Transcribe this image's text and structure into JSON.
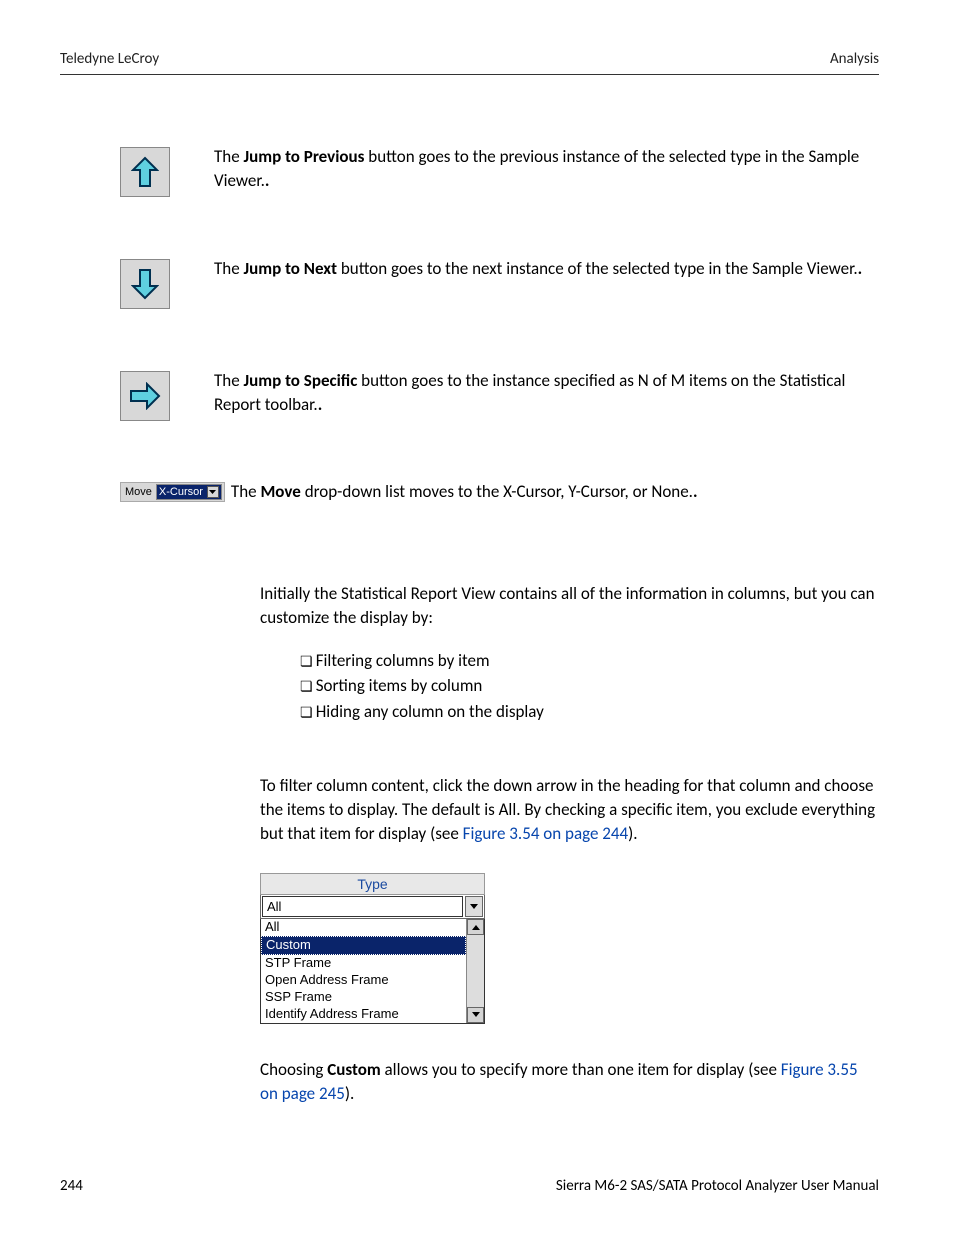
{
  "header": {
    "left": "Teledyne LeCroy",
    "right": "Analysis"
  },
  "items": [
    {
      "icon": "up-arrow",
      "prefix": "The ",
      "bold": "Jump to Previous",
      "suffix": " button goes to the previous instance of the selected type in the Sample Viewer."
    },
    {
      "icon": "down-arrow",
      "prefix": "The ",
      "bold": "Jump to Next",
      "suffix": " button goes to the next instance of the selected type in the Sample Viewer."
    },
    {
      "icon": "right-arrow",
      "prefix": "The ",
      "bold": "Jump to Specific",
      "suffix": " button goes to the instance specified as N of M items on the Statistical Report toolbar."
    }
  ],
  "move": {
    "label": "Move",
    "selected": "X-Cursor",
    "prefix": " The ",
    "bold": "Move",
    "suffix": " drop-down list moves to the X-Cursor, Y-Cursor, or None."
  },
  "intro": "Initially the Statistical Report View contains all of the information in columns, but you can customize the display by:",
  "bullets": [
    "Filtering columns by item",
    "Sorting items by column",
    "Hiding any column on the display"
  ],
  "filter_text": {
    "part1": "To filter column content, click the down arrow in the heading for that column and choose the items to display. The default is All. By checking a specific item, you exclude everything but that item for display (see ",
    "link": "Figure 3.54 on page 244",
    "part2": ")."
  },
  "dropdown": {
    "header": "Type",
    "value": "All",
    "options": [
      "All",
      "Custom",
      "STP Frame",
      "Open Address Frame",
      "SSP Frame",
      "Identify Address Frame"
    ],
    "selected_index": 1
  },
  "custom_text": {
    "part1": "Choosing ",
    "bold": "Custom",
    "part2": " allows you to specify more than one item for display (see ",
    "link": "Figure 3.55 on page 245",
    "part3": ")."
  },
  "footer": {
    "page": "244",
    "title": "Sierra M6-2 SAS/SATA Protocol Analyzer User Manual"
  }
}
